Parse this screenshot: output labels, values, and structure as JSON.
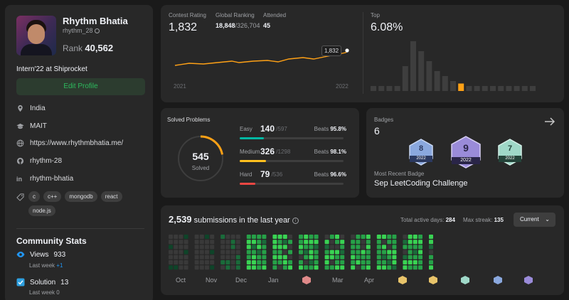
{
  "profile": {
    "name": "Rhythm Bhatia",
    "username": "rhythm_28",
    "rank_label": "Rank",
    "rank_value": "40,562",
    "bio": "Intern'22 at Shiprocket",
    "edit_label": "Edit Profile",
    "location": "India",
    "school": "MAIT",
    "website": "https://www.rhythmbhatia.me/",
    "github": "rhythm-28",
    "linkedin": "rhythm-bhatia",
    "skills": [
      "c",
      "c++",
      "mongodb",
      "react",
      "node.js"
    ]
  },
  "community": {
    "title": "Community Stats",
    "views_label": "Views",
    "views_value": "933",
    "views_sub": "Last week",
    "views_delta": "+1",
    "solution_label": "Solution",
    "solution_value": "13",
    "solution_sub": "Last week",
    "solution_delta": "0"
  },
  "contest": {
    "rating_label": "Contest Rating",
    "rating_value": "1,832",
    "global_label": "Global Ranking",
    "global_value": "18,848",
    "global_total": "/326,704",
    "attended_label": "Attended",
    "attended_value": "45",
    "tooltip": "1,832",
    "year_start": "2021",
    "year_end": "2022",
    "top_label": "Top",
    "top_value": "6.08%",
    "histogram": [
      1,
      1,
      1,
      1,
      5,
      10,
      8,
      6,
      4,
      3,
      2,
      1.5,
      1,
      1,
      1,
      1,
      1,
      1,
      1,
      1,
      1
    ],
    "highlight_index": 11,
    "colors": {
      "line": "#ffa116",
      "histogram": "#3e3e3e",
      "highlight": "#ffa116"
    }
  },
  "solved": {
    "title": "Solved Problems",
    "total": "545",
    "total_label": "Solved",
    "beats_label": "Beats",
    "rows": [
      {
        "name": "Easy",
        "count": "140",
        "total": "/597",
        "beats": "95.8%",
        "fraction": 0.2345,
        "color": "#00b8a3"
      },
      {
        "name": "Medium",
        "count": "326",
        "total": "/1298",
        "beats": "98.1%",
        "fraction": 0.2512,
        "color": "#ffc01e"
      },
      {
        "name": "Hard",
        "count": "79",
        "total": "/536",
        "beats": "96.6%",
        "fraction": 0.1474,
        "color": "#ef4743"
      }
    ],
    "ring_fraction": 0.22
  },
  "badges": {
    "title": "Badges",
    "count": "6",
    "items": [
      {
        "num": "8",
        "year": "2022"
      },
      {
        "num": "9",
        "year": "2022"
      },
      {
        "num": "7",
        "year": "2022"
      }
    ],
    "recent_label": "Most Recent Badge",
    "recent_name": "Sep LeetCoding Challenge",
    "arrow_icon": "arrow-right-icon"
  },
  "submissions": {
    "count": "2,539",
    "text": "submissions in the last year",
    "active_label": "Total active days:",
    "active_value": "284",
    "streak_label": "Max streak:",
    "streak_value": "135",
    "dropdown": "Current",
    "months": [
      "Oct",
      "Nov",
      "Dec",
      "Jan",
      "Mar",
      "Apr"
    ]
  }
}
